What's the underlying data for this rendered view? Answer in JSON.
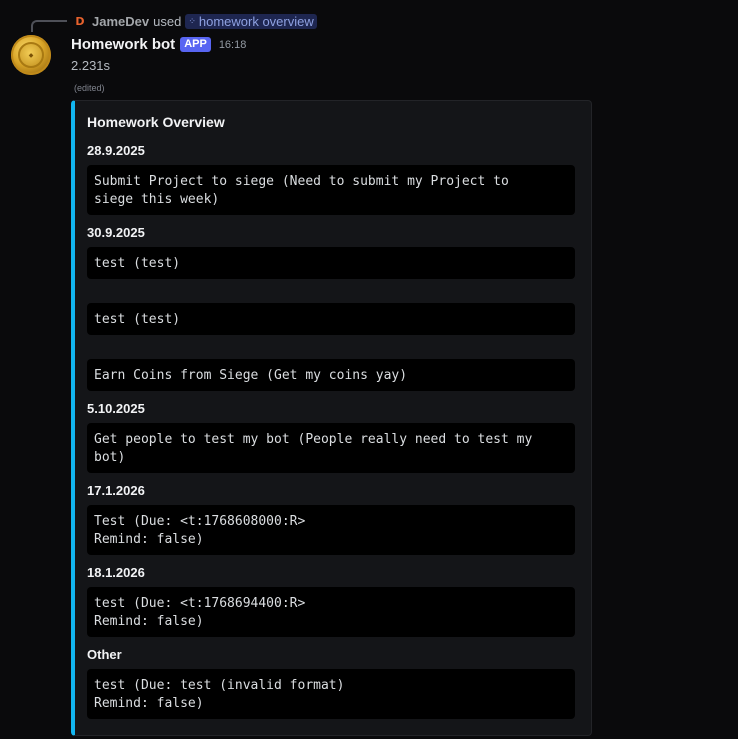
{
  "reply": {
    "user": "JameDev",
    "used_text": "used",
    "command": "homework overview"
  },
  "message": {
    "author": "Homework bot",
    "badge": "APP",
    "timestamp": "16:18",
    "content": "2.231s",
    "edited": "(edited)"
  },
  "embed": {
    "accent_color": "#12b6f0",
    "title": "Homework Overview",
    "fields": [
      {
        "name": "28.9.2025",
        "blocks": [
          "Submit Project to siege (Need to submit my Project to\nsiege this week)"
        ]
      },
      {
        "name": "30.9.2025",
        "blocks": [
          "test (test)",
          "test (test)",
          "Earn Coins from Siege (Get my coins yay)"
        ]
      },
      {
        "name": "5.10.2025",
        "blocks": [
          "Get people to test my bot (People really need to test my\nbot)"
        ]
      },
      {
        "name": "17.1.2026",
        "blocks": [
          "Test (Due: <t:1768608000:R>\nRemind: false)"
        ]
      },
      {
        "name": "18.1.2026",
        "blocks": [
          "test (Due: <t:1768694400:R>\nRemind: false)"
        ]
      },
      {
        "name": "Other",
        "blocks": [
          "test (Due: test (invalid format)\nRemind: false)"
        ]
      }
    ]
  }
}
